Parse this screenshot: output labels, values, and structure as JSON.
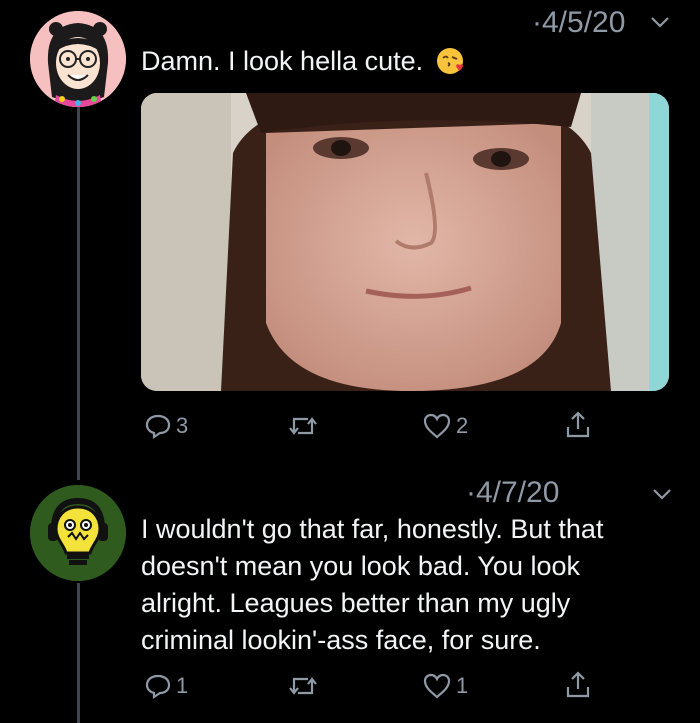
{
  "tweets": [
    {
      "date": "·4/5/20",
      "text": "Damn. I look hella cute.",
      "emoji": "kissing-face-emoji",
      "actions": {
        "replies": "3",
        "retweets": "",
        "likes": "2"
      }
    },
    {
      "date": "·4/7/20",
      "text_lines": [
        "I wouldn't go that far, honestly. But that",
        "doesn't mean you look bad. You look",
        "alright. Leagues better than my ugly",
        "criminal lookin'-ass face, for sure."
      ],
      "actions": {
        "replies": "1",
        "retweets": "",
        "likes": "1"
      }
    }
  ],
  "colors": {
    "background": "#000000",
    "muted": "#8f9aa6",
    "thread_line": "#3d4550",
    "avatar2_bg": "#2f5b1e"
  }
}
